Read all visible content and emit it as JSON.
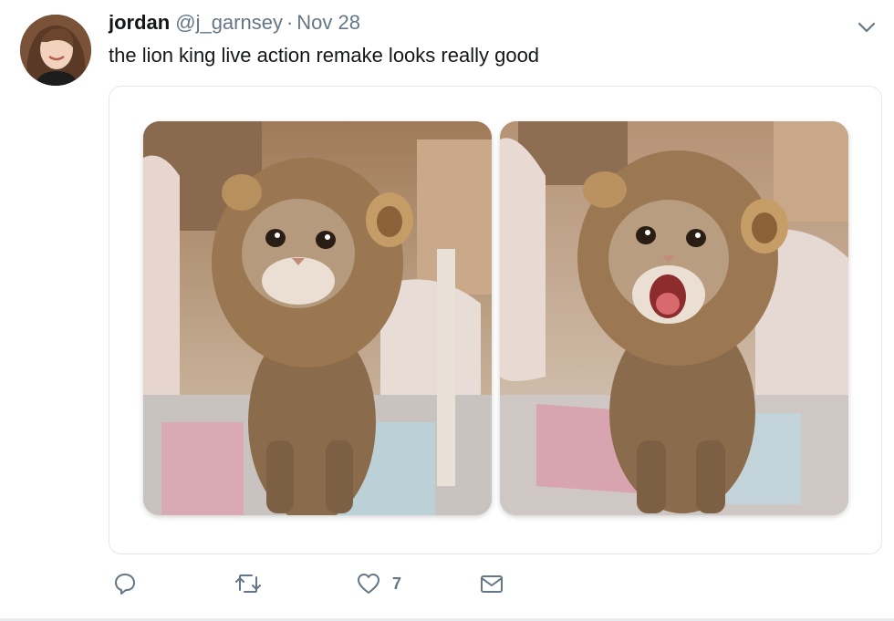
{
  "tweet": {
    "display_name": "jordan",
    "handle": "@j_garnsey",
    "separator": "·",
    "date": "Nov 28",
    "text": "the lion king live action remake looks really good"
  },
  "media": {
    "photos": [
      "cat-in-lion-mane-calm",
      "cat-in-lion-mane-roaring"
    ]
  },
  "actions": {
    "reply_icon": "reply-icon",
    "retweet_icon": "retweet-icon",
    "like_icon": "heart-icon",
    "like_count": "7",
    "dm_icon": "envelope-icon"
  },
  "colors": {
    "text_primary": "#14171a",
    "text_secondary": "#657786",
    "border": "#e1e8ed"
  }
}
